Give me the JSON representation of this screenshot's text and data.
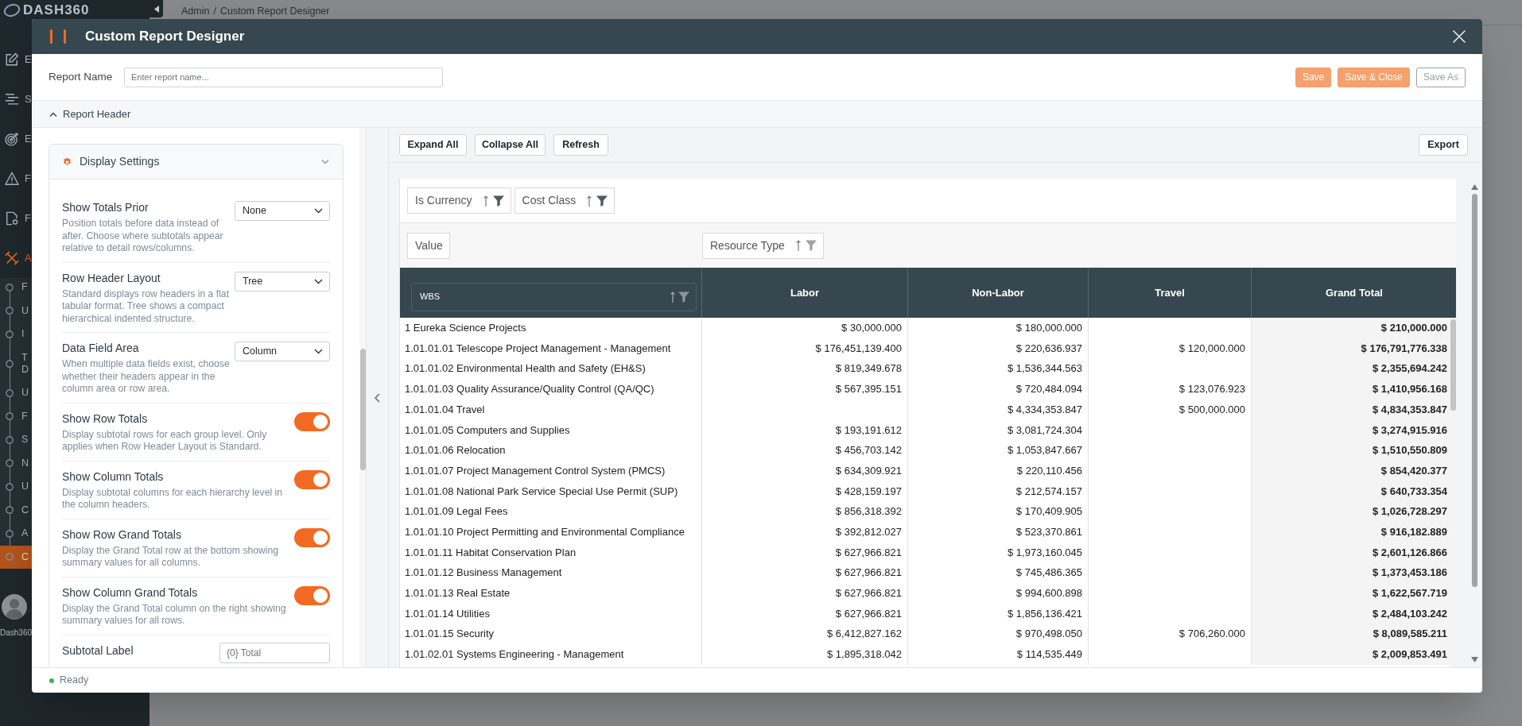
{
  "app": {
    "logo": "DASH360",
    "breadcrumb": {
      "items": [
        "Admin",
        "Custom Report Designer"
      ],
      "separator": "/"
    },
    "nav": [
      {
        "label": "E",
        "selected": false
      },
      {
        "label": "S",
        "selected": false
      },
      {
        "label": "E",
        "selected": false
      },
      {
        "label": "F",
        "selected": false
      },
      {
        "label": "F",
        "selected": false
      },
      {
        "label": "A",
        "selected": true,
        "children": [
          {
            "label": "F",
            "selected": false
          },
          {
            "label": "U",
            "selected": false
          },
          {
            "label": "I",
            "selected": false
          },
          {
            "label": "T D",
            "selected": false
          },
          {
            "label": "U",
            "selected": false
          },
          {
            "label": "F",
            "selected": false
          },
          {
            "label": "S",
            "selected": false
          },
          {
            "label": "N",
            "selected": false
          },
          {
            "label": "U",
            "selected": false
          },
          {
            "label": "C",
            "selected": false
          },
          {
            "label": "A",
            "selected": false
          },
          {
            "label": "C",
            "selected": true
          }
        ]
      }
    ],
    "user": "Dash360"
  },
  "dialog": {
    "title": "Custom Report Designer",
    "report_name": {
      "label": "Report Name",
      "placeholder": "Enter report name..."
    },
    "actions": [
      {
        "label": "Save",
        "kind": "primary"
      },
      {
        "label": "Save & Close",
        "kind": "primary"
      },
      {
        "label": "Save As",
        "kind": "outline"
      }
    ],
    "report_header": {
      "label": "Report Header",
      "expanded": true
    },
    "display_settings": {
      "title": "Display Settings",
      "settings": [
        {
          "kind": "select",
          "title": "Show Totals Prior",
          "description": "Position totals before data instead of after. Choose where subtotals appear relative to detail rows/columns.",
          "value": "None"
        },
        {
          "kind": "select",
          "title": "Row Header Layout",
          "description": "Standard displays row headers in a flat tabular format. Tree shows a compact hierarchical indented structure.",
          "value": "Tree"
        },
        {
          "kind": "select",
          "title": "Data Field Area",
          "description": "When multiple data fields exist, choose whether their headers appear in the column area or row area.",
          "value": "Column"
        },
        {
          "kind": "toggle",
          "title": "Show Row Totals",
          "description": "Display subtotal rows for each group level. Only applies when Row Header Layout is Standard.",
          "on": true
        },
        {
          "kind": "toggle",
          "title": "Show Column Totals",
          "description": "Display subtotal columns for each hierarchy level in the column headers.",
          "on": true
        },
        {
          "kind": "toggle",
          "title": "Show Row Grand Totals",
          "description": "Display the Grand Total row at the bottom showing summary values for all columns.",
          "on": true
        },
        {
          "kind": "toggle",
          "title": "Show Column Grand Totals",
          "description": "Display the Grand Total column on the right showing summary values for all rows.",
          "on": true
        },
        {
          "kind": "text",
          "title": "Subtotal Label",
          "placeholder": "{0} Total"
        }
      ]
    },
    "toolbar": {
      "buttons": [
        {
          "label": "Expand All"
        },
        {
          "label": "Collapse All"
        },
        {
          "label": "Refresh"
        }
      ],
      "export": {
        "label": "Export"
      }
    },
    "pivot": {
      "filter_fields": [
        {
          "label": "Is Currency",
          "filtered": true
        },
        {
          "label": "Cost Class",
          "filtered": true
        }
      ],
      "data_fields": [
        {
          "label": "Value"
        }
      ],
      "column_fields": [
        {
          "label": "Resource Type",
          "filtered": false
        }
      ],
      "row_fields": [
        {
          "label": "WBS",
          "filtered": false
        }
      ],
      "columns": [
        "Labor",
        "Non-Labor",
        "Travel",
        "Grand Total"
      ],
      "rows": [
        {
          "label": "1 Eureka Science Projects",
          "cells": [
            "$ 30,000.000",
            "$ 180,000.000",
            null,
            "$ 210,000.000"
          ]
        },
        {
          "label": "1.01.01.01 Telescope Project Management - Management",
          "cells": [
            "$ 176,451,139.400",
            "$ 220,636.937",
            "$ 120,000.000",
            "$ 176,791,776.338"
          ]
        },
        {
          "label": "1.01.01.02 Environmental Health and Safety (EH&S)",
          "cells": [
            "$ 819,349.678",
            "$ 1,536,344.563",
            null,
            "$ 2,355,694.242"
          ]
        },
        {
          "label": "1.01.01.03 Quality Assurance/Quality Control (QA/QC)",
          "cells": [
            "$ 567,395.151",
            "$ 720,484.094",
            "$ 123,076.923",
            "$ 1,410,956.168"
          ]
        },
        {
          "label": "1.01.01.04 Travel",
          "cells": [
            null,
            "$ 4,334,353.847",
            "$ 500,000.000",
            "$ 4,834,353.847"
          ]
        },
        {
          "label": "1.01.01.05 Computers and Supplies",
          "cells": [
            "$ 193,191.612",
            "$ 3,081,724.304",
            null,
            "$ 3,274,915.916"
          ]
        },
        {
          "label": "1.01.01.06 Relocation",
          "cells": [
            "$ 456,703.142",
            "$ 1,053,847.667",
            null,
            "$ 1,510,550.809"
          ]
        },
        {
          "label": "1.01.01.07 Project Management Control System (PMCS)",
          "cells": [
            "$ 634,309.921",
            "$ 220,110.456",
            null,
            "$ 854,420.377"
          ]
        },
        {
          "label": "1.01.01.08 National Park Service Special Use Permit (SUP)",
          "cells": [
            "$ 428,159.197",
            "$ 212,574.157",
            null,
            "$ 640,733.354"
          ]
        },
        {
          "label": "1.01.01.09 Legal Fees",
          "cells": [
            "$ 856,318.392",
            "$ 170,409.905",
            null,
            "$ 1,026,728.297"
          ]
        },
        {
          "label": "1.01.01.10 Project Permitting and Environmental Compliance",
          "cells": [
            "$ 392,812.027",
            "$ 523,370.861",
            null,
            "$ 916,182.889"
          ]
        },
        {
          "label": "1.01.01.11 Habitat Conservation Plan",
          "cells": [
            "$ 627,966.821",
            "$ 1,973,160.045",
            null,
            "$ 2,601,126.866"
          ]
        },
        {
          "label": "1.01.01.12 Business Management",
          "cells": [
            "$ 627,966.821",
            "$ 745,486.365",
            null,
            "$ 1,373,453.186"
          ]
        },
        {
          "label": "1.01.01.13 Real Estate",
          "cells": [
            "$ 627,966.821",
            "$ 994,600.898",
            null,
            "$ 1,622,567.719"
          ]
        },
        {
          "label": "1.01.01.14 Utilities",
          "cells": [
            "$ 627,966.821",
            "$ 1,856,136.421",
            null,
            "$ 2,484,103.242"
          ]
        },
        {
          "label": "1.01.01.15 Security",
          "cells": [
            "$ 6,412,827.162",
            "$ 970,498.050",
            "$ 706,260.000",
            "$ 8,089,585.211"
          ]
        },
        {
          "label": "1.01.02.01 Systems Engineering - Management",
          "cells": [
            "$ 1,895,318.042",
            "$ 114,535.449",
            null,
            "$ 2,009,853.491"
          ]
        }
      ]
    },
    "status": "Ready"
  }
}
